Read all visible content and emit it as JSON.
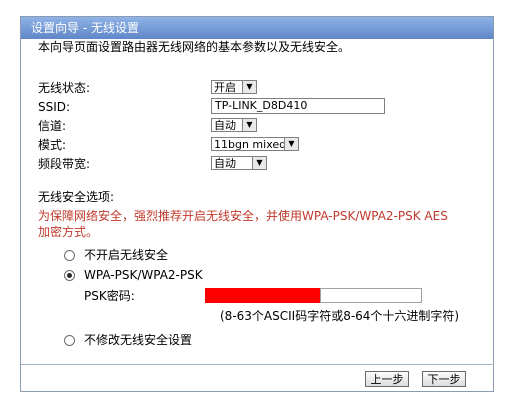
{
  "title": "设置向导 - 无线设置",
  "intro": "本向导页面设置路由器无线网络的基本参数以及无线安全。",
  "fields": {
    "wireless_status": {
      "label": "无线状态:",
      "value": "开启"
    },
    "ssid": {
      "label": "SSID:",
      "value": "TP-LINK_D8D410"
    },
    "channel": {
      "label": "信道:",
      "value": "自动"
    },
    "mode": {
      "label": "模式:",
      "value": "11bgn mixed"
    },
    "bandwidth": {
      "label": "频段带宽:",
      "value": "自动"
    }
  },
  "security": {
    "section_label": "无线安全选项:",
    "warning": "为保障网络安全，强烈推荐开启无线安全，并使用WPA-PSK/WPA2-PSK AES加密方式。",
    "options": [
      {
        "label": "不开启无线安全",
        "selected": false
      },
      {
        "label": "WPA-PSK/WPA2-PSK",
        "selected": true
      },
      {
        "label": "不修改无线安全设置",
        "selected": false
      }
    ],
    "psk_label": "PSK密码:",
    "psk_hint": "(8-63个ASCII码字符或8-64个十六进制字符)"
  },
  "buttons": {
    "prev": "上一步",
    "next": "下一步"
  },
  "colors": {
    "title_bar": "#6f95d3",
    "warning": "#c0392b",
    "redaction": "#ff0000"
  }
}
